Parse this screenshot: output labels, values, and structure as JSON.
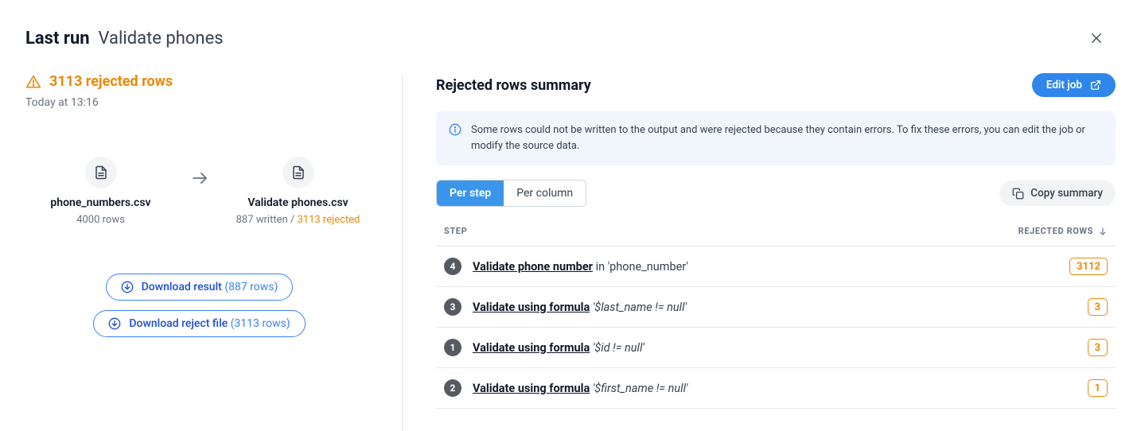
{
  "header": {
    "title_prefix": "Last run",
    "title_job": "Validate phones"
  },
  "left": {
    "rejected_banner": "3113 rejected rows",
    "timestamp": "Today at 13:16",
    "source": {
      "filename": "phone_numbers.csv",
      "subline": "4000 rows"
    },
    "target": {
      "filename": "Validate phones.csv",
      "written_text": "887 written / ",
      "rejected_text": "3113 rejected"
    },
    "download_result": {
      "label": "Download result",
      "paren": "(887 rows)"
    },
    "download_reject": {
      "label": "Download reject file",
      "paren": "(3113 rows)"
    }
  },
  "right": {
    "title": "Rejected rows summary",
    "edit_job_label": "Edit job",
    "info_text": "Some rows could not be written to the output and were rejected because they contain errors. To fix these errors, you can edit the job or modify the source data.",
    "seg_per_step": "Per step",
    "seg_per_column": "Per column",
    "copy_summary": "Copy summary",
    "col_step": "STEP",
    "col_rejected": "REJECTED ROWS",
    "rows": [
      {
        "num": "4",
        "action": "Validate phone number",
        "detail_prefix": " in ",
        "detail": "'phone_number'",
        "italic": false,
        "count": "3112"
      },
      {
        "num": "3",
        "action": "Validate using formula",
        "detail_prefix": " ",
        "detail": "'$last_name != null'",
        "italic": true,
        "count": "3"
      },
      {
        "num": "1",
        "action": "Validate using formula",
        "detail_prefix": " ",
        "detail": "'$id != null'",
        "italic": true,
        "count": "3"
      },
      {
        "num": "2",
        "action": "Validate using formula",
        "detail_prefix": " ",
        "detail": "'$first_name != null'",
        "italic": true,
        "count": "1"
      }
    ]
  }
}
